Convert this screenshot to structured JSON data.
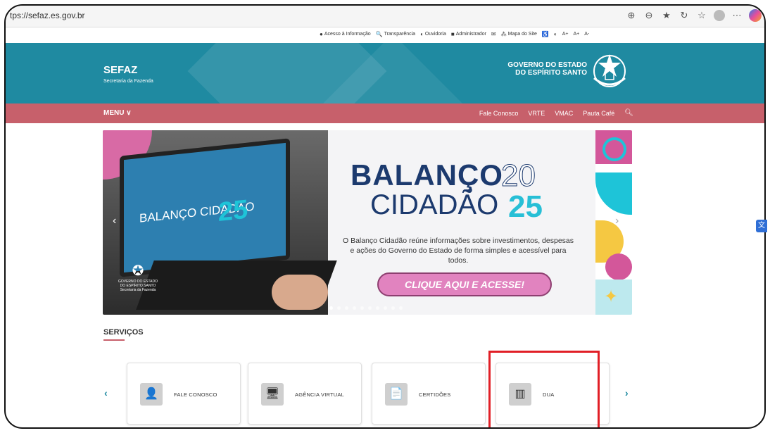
{
  "browser": {
    "url": "tps://sefaz.es.gov.br",
    "icons": [
      "zoom-in-icon",
      "zoom-out-icon",
      "favorite-icon",
      "refresh-icon",
      "collections-icon",
      "profile-icon",
      "more-icon",
      "copilot-icon"
    ]
  },
  "utility": {
    "links": [
      {
        "icon": "●",
        "label": "Acesso à Informação"
      },
      {
        "icon": "🔍",
        "label": "Transparência"
      },
      {
        "icon": "◐",
        "label": "Ouvidoria"
      },
      {
        "icon": "■",
        "label": "Administrador"
      },
      {
        "icon": "✉",
        "label": ""
      },
      {
        "icon": "⁂",
        "label": "Mapa do Site"
      },
      {
        "icon": "♿",
        "label": ""
      },
      {
        "icon": "◐",
        "label": ""
      },
      {
        "icon": "",
        "label": "A+"
      },
      {
        "icon": "",
        "label": "A+"
      },
      {
        "icon": "",
        "label": "A-"
      }
    ]
  },
  "header": {
    "title": "SEFAZ",
    "subtitle": "Secretaria da Fazenda",
    "gov_line1": "GOVERNO DO ESTADO",
    "gov_line2": "DO ESPÍRITO SANTO",
    "primary_color": "#1f8aa1"
  },
  "menubar": {
    "menu_label": "MENU ∨",
    "links": [
      "Fale Conosco",
      "VRTE",
      "VMAC",
      "Pauta Café"
    ],
    "color": "#c7606b"
  },
  "banner": {
    "laptop_text": "BALANÇO CIDADÃO",
    "laptop_number": "25",
    "seal_text": "GOVERNO DO ESTADO DO ESPÍRITO SANTO Secretaria da Fazenda",
    "headline1": "BALANÇO",
    "headline1_num": "20",
    "headline2": "CIDADÃO",
    "headline2_num": "25",
    "description": "O Balanço Cidadão reúne informações sobre investimentos, despesas e ações do Governo do Estado de forma simples e acessível para todos.",
    "cta": "CLIQUE AQUI E ACESSE!",
    "dot_count": 10,
    "active_dot": 0
  },
  "services": {
    "title": "SERVIÇOS",
    "cards": [
      {
        "label": "FALE CONOSCO",
        "icon": "👤"
      },
      {
        "label": "AGÊNCIA VIRTUAL",
        "icon": "🖥"
      },
      {
        "label": "CERTIDÕES",
        "icon": "📄"
      },
      {
        "label": "DUA",
        "icon": "▥"
      }
    ],
    "prev": "‹",
    "next": "›"
  },
  "highlight_color": "#e11f26"
}
